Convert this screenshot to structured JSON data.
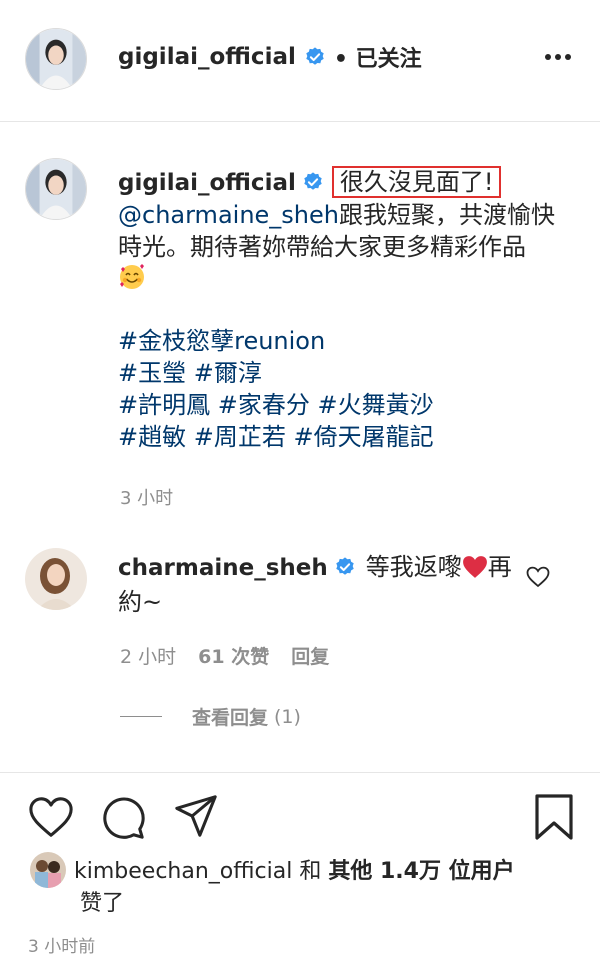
{
  "header": {
    "username": "gigilai_official",
    "follow_status": "• 已关注",
    "more_icon": "more-horizontal-icon",
    "verified_icon": "verified-badge-icon"
  },
  "caption": {
    "username": "gigilai_official",
    "highlighted_text": "很久沒見面了!",
    "mention": "@charmaine_sheh",
    "text_1": "跟我短聚，共渡愉快",
    "text_2": "時光。期待著妳帶給大家更多精彩作品",
    "emoji_icon": "smiling-face-with-hearts-icon",
    "hashtags": [
      [
        "#金枝慾孽reunion"
      ],
      [
        "#玉瑩",
        "#爾淳"
      ],
      [
        "#許明鳳",
        "#家春分",
        "#火舞黃沙"
      ],
      [
        "#趙敏",
        "#周芷若",
        "#倚天屠龍記"
      ]
    ],
    "timestamp": "3 小时"
  },
  "comment": {
    "username": "charmaine_sheh",
    "text_before": "等我返嚟",
    "heart_emoji": "red-heart-icon",
    "text_after": "再約~",
    "time": "2 小时",
    "likes": "61 次赞",
    "reply_label": "回复",
    "view_replies_label": "查看回复",
    "view_replies_count": "(1)",
    "like_icon": "heart-outline-icon"
  },
  "actions": {
    "like_icon": "heart-outline-icon",
    "comment_icon": "comment-bubble-icon",
    "share_icon": "paper-plane-icon",
    "save_icon": "bookmark-outline-icon"
  },
  "likes": {
    "username": "kimbeechan_official",
    "conjunction": "和",
    "others": "其他 1.4万 位用户",
    "suffix": "赞了"
  },
  "post_time": "3 小时前",
  "colors": {
    "text": "#262626",
    "secondary": "#8e8e8e",
    "link": "#00376b",
    "verified": "#3897f0",
    "highlight_box": "#e0302e",
    "heart": "#e0245e"
  }
}
